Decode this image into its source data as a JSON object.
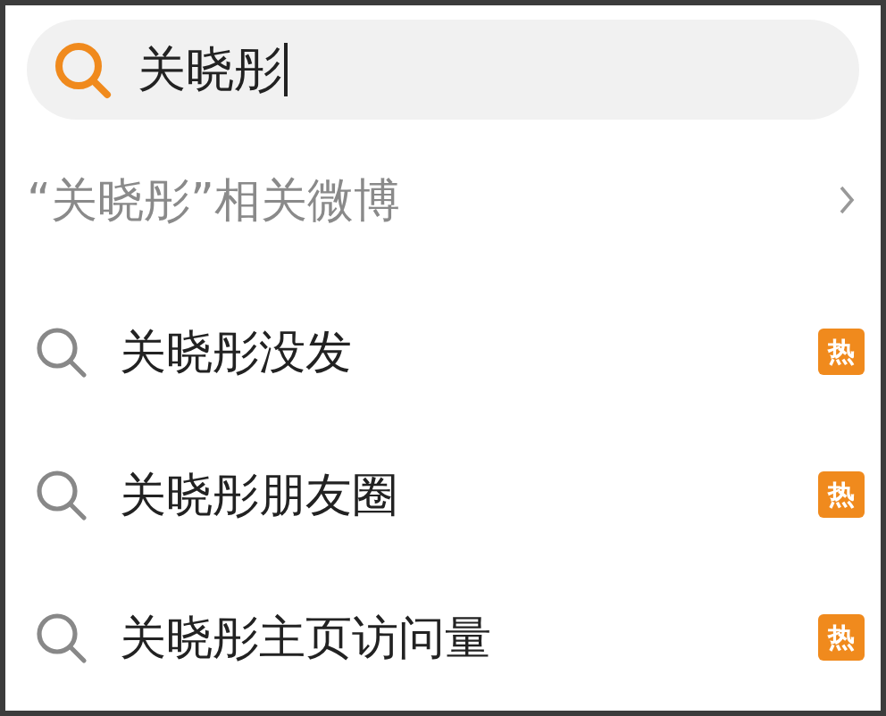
{
  "search": {
    "value": "关晓彤"
  },
  "related": {
    "label": "“关晓彤”相关微博"
  },
  "suggestions": [
    {
      "text": "关晓彤没发",
      "badge": "热"
    },
    {
      "text": "关晓彤朋友圈",
      "badge": "热"
    },
    {
      "text": "关晓彤主页访问量",
      "badge": "热"
    }
  ]
}
